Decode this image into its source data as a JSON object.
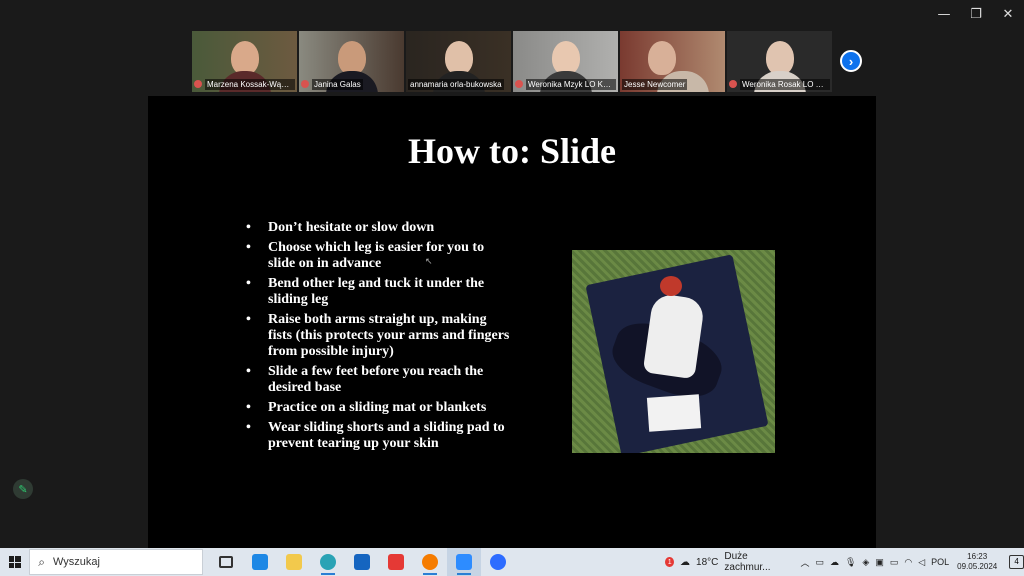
{
  "window": {
    "controls": {
      "minimize": "—",
      "restore": "❐",
      "close": "✕"
    }
  },
  "gallery": {
    "participants": [
      {
        "name": "Marzena Kossak-Wąch..."
      },
      {
        "name": "Janina Galas"
      },
      {
        "name": "annamaria orla-bukowska"
      },
      {
        "name": "Weronika Mzyk LO KO..."
      },
      {
        "name": "Jesse Newcomer"
      },
      {
        "name": "Weronika Rosak LO KO..."
      }
    ],
    "next_icon": "›"
  },
  "slide": {
    "title": "How to: Slide",
    "bullets": [
      "Don’t hesitate or slow down",
      "Choose which leg is easier for you to slide on in advance",
      "Bend other leg and tuck it under the sliding leg",
      "Raise both arms straight up, making fists (this protects your arms and fingers from possible injury)",
      "Slide a few feet before you reach the desired base",
      "Practice on a sliding mat or blankets",
      "Wear sliding shorts and a sliding pad to prevent tearing up your skin"
    ]
  },
  "taskbar": {
    "search_label": "Wyszukaj",
    "weather_badge": "1",
    "weather_temp": "18°C",
    "weather_desc": "Duże zachmur...",
    "language": "POL",
    "time": "16:23",
    "date": "09.05.2024",
    "notif_count": "4"
  },
  "colors": {
    "active_speaker": "#2ecc71",
    "accent": "#0e72ed",
    "taskbar_bg": "#dfe6ee"
  }
}
